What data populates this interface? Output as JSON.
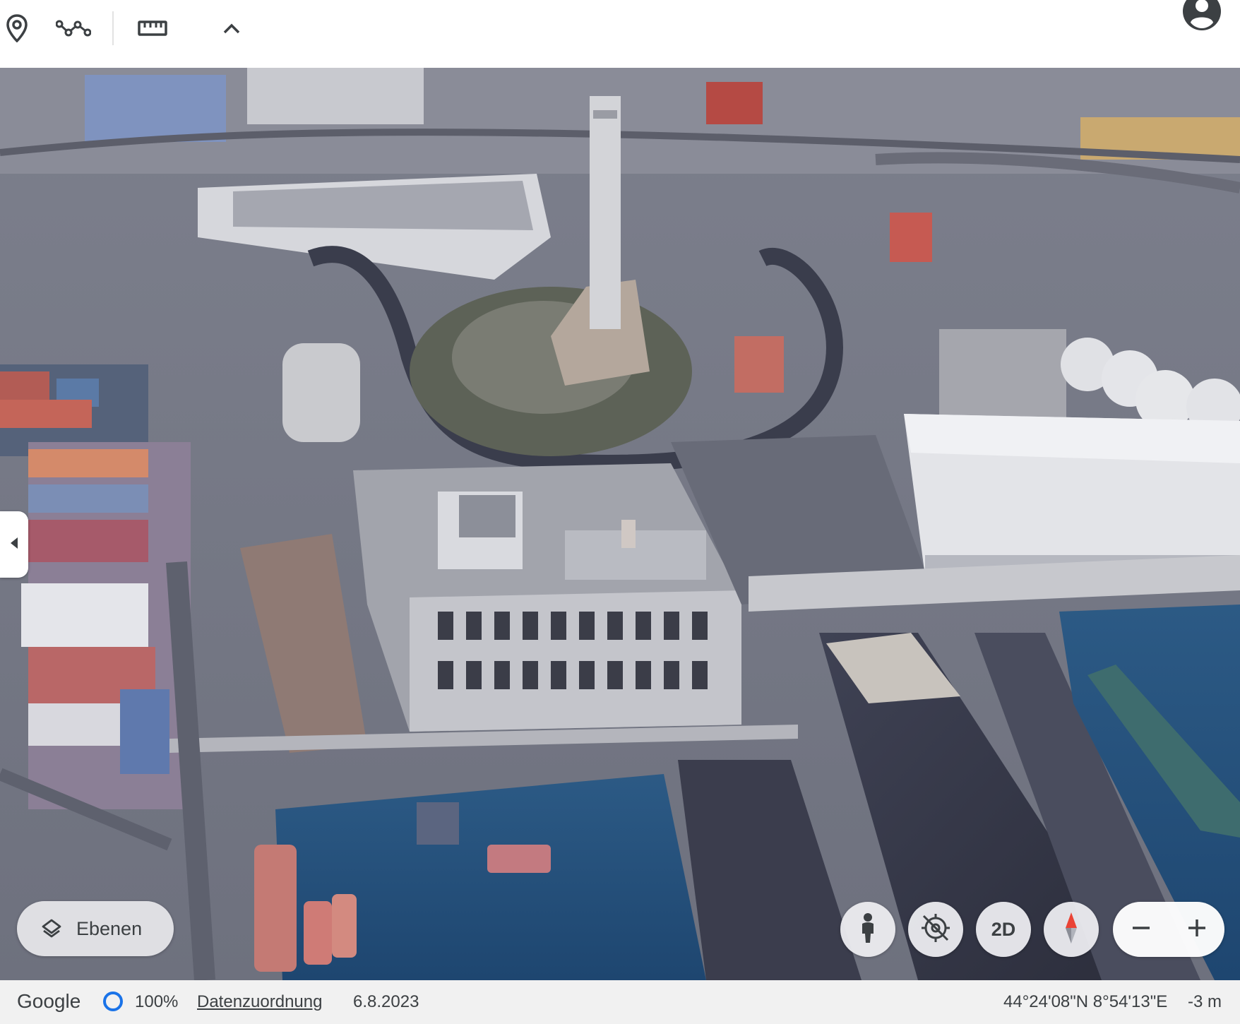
{
  "toolbar": {
    "buttons": [
      {
        "name": "placemark",
        "icon": "location-pin-icon"
      },
      {
        "name": "path",
        "icon": "path-icon"
      },
      {
        "name": "measure",
        "icon": "ruler-icon"
      },
      {
        "name": "collapse",
        "icon": "chevron-up-icon"
      }
    ],
    "account_icon": "account-circle-icon"
  },
  "map": {
    "side_panel_toggle_icon": "chevron-left-icon",
    "layers_button": {
      "label": "Ebenen",
      "icon": "layers-icon"
    },
    "controls": {
      "pegman_icon": "pegman-icon",
      "tilt_reset_icon": "tilt-reset-icon",
      "view_mode_label": "2D",
      "compass_icon": "compass-icon",
      "zoom_out_icon": "minus-icon",
      "zoom_in_icon": "plus-icon"
    }
  },
  "status": {
    "logo": "Google",
    "loading_percent": "100%",
    "attribution_link": "Datenzuordnung",
    "imagery_date": "6.8.2023",
    "coordinates": "44°24'08\"N 8°54'13\"E",
    "altitude": "-3 m"
  },
  "colors": {
    "toolbar_icon": "#3c4043",
    "loading_ring": "#1a73e8",
    "compass_red": "#ea4335",
    "water": "#26507a",
    "terrain": "#8c8e99"
  }
}
